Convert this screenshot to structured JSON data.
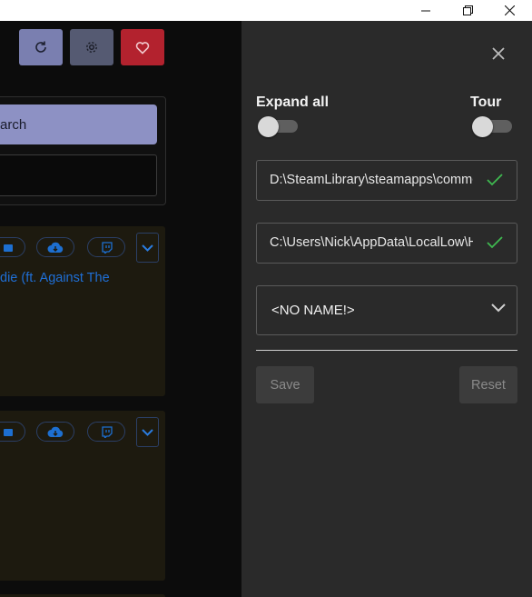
{
  "app": {
    "cards": [
      {
        "title": "die (ft. Against The"
      },
      {
        "title": ""
      }
    ],
    "search": {
      "button_label": "arch"
    }
  },
  "settings": {
    "expand_all_label": "Expand all",
    "tour_label": "Tour",
    "expand_all_on": false,
    "tour_on": false,
    "game_path": "D:\\SteamLibrary\\steamapps\\common\\",
    "save_path": "C:\\Users\\Nick\\AppData\\LocalLow\\Hinterland\\",
    "profile_selected": "<NO NAME!>",
    "save_label": "Save",
    "reset_label": "Reset"
  },
  "colors": {
    "accent_green": "#3fb950",
    "heart_red": "#b3222e",
    "link_blue": "#1f6fd6"
  }
}
